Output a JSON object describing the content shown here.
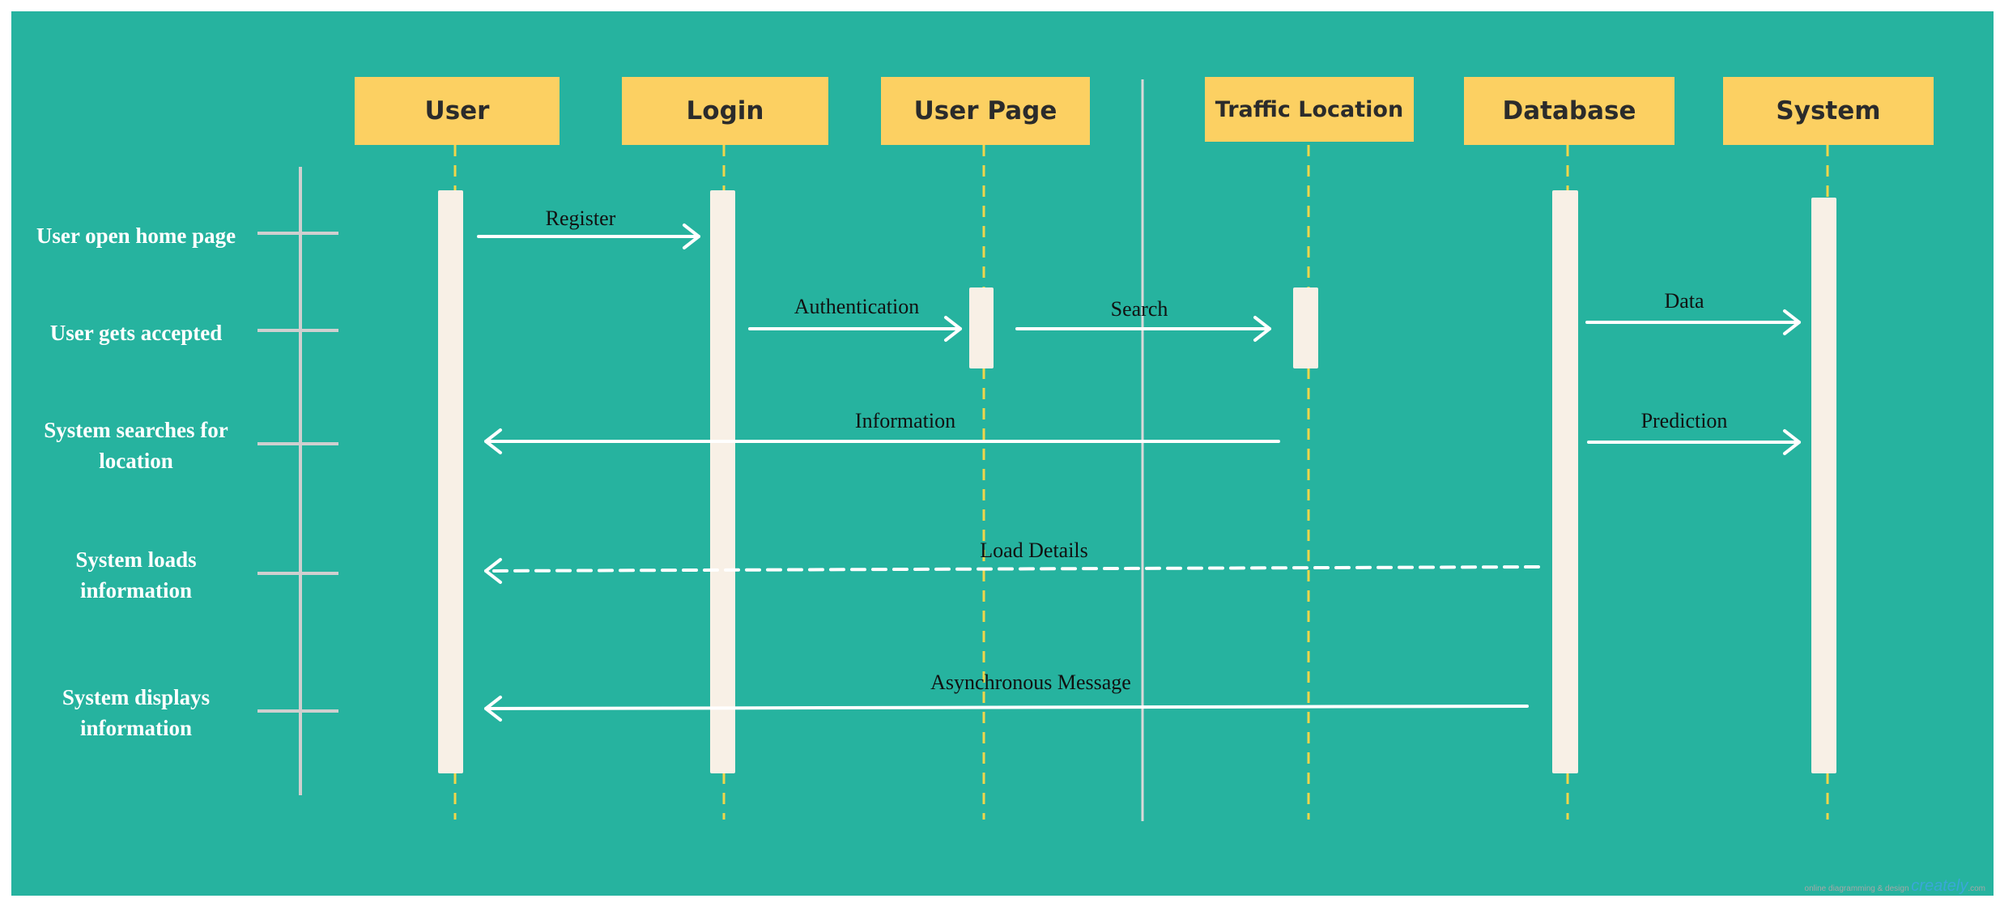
{
  "lifelines": [
    {
      "id": "user",
      "label": "User"
    },
    {
      "id": "login",
      "label": "Login"
    },
    {
      "id": "userpage",
      "label": "User Page"
    },
    {
      "id": "traffic",
      "label": "Traffic Location"
    },
    {
      "id": "database",
      "label": "Database"
    },
    {
      "id": "system",
      "label": "System"
    }
  ],
  "steps": [
    {
      "label": "User open home page"
    },
    {
      "label": "User gets accepted"
    },
    {
      "label": "System searches for location"
    },
    {
      "label": "System loads information"
    },
    {
      "label": "System displays information"
    }
  ],
  "messages": [
    {
      "label": "Register",
      "from": "user",
      "to": "login",
      "style": "solid"
    },
    {
      "label": "Authentication",
      "from": "login",
      "to": "userpage",
      "style": "solid"
    },
    {
      "label": "Search",
      "from": "userpage",
      "to": "traffic",
      "style": "solid"
    },
    {
      "label": "Data",
      "from": "database",
      "to": "system",
      "style": "solid"
    },
    {
      "label": "Information",
      "from": "traffic",
      "to": "user",
      "style": "solid"
    },
    {
      "label": "Prediction",
      "from": "database",
      "to": "system",
      "style": "solid"
    },
    {
      "label": "Load Details",
      "from": "database",
      "to": "user",
      "style": "dashed"
    },
    {
      "label": "Asynchronous Message",
      "from": "database",
      "to": "user",
      "style": "solid"
    }
  ],
  "watermark": {
    "tagline": "online diagramming & design",
    "brand": "creately",
    "suffix": ".com"
  },
  "colors": {
    "background": "#26b39f",
    "header": "#fcd062",
    "activation": "#f8f0e6",
    "lifeline": "#f0d64a",
    "arrow": "#ffffff",
    "axis": "#cfcfcf"
  }
}
